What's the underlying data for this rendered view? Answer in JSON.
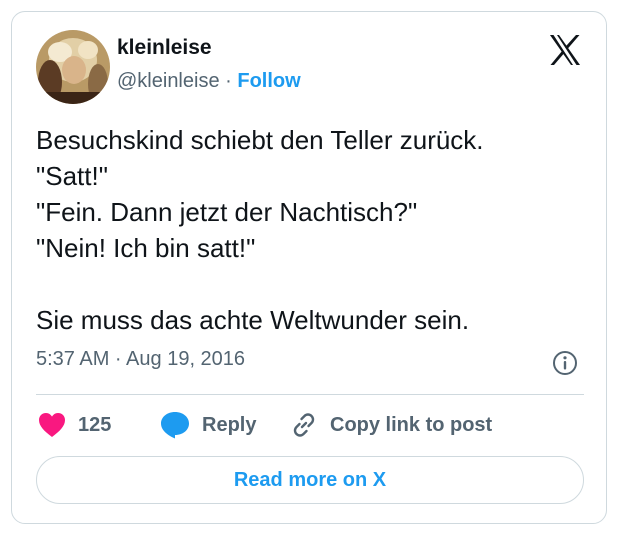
{
  "author": {
    "display_name": "kleinleise",
    "handle": "@kleinleise",
    "separator": "·",
    "follow_label": "Follow"
  },
  "tweet": {
    "lines": [
      "Besuchskind schiebt den Teller zurück.",
      "\"Satt!\"",
      "\"Fein. Dann jetzt der Nachtisch?\"",
      "\"Nein! Ich bin satt!\"",
      "",
      "Sie muss das achte Weltwunder sein."
    ],
    "timestamp": "5:37 AM · Aug 19, 2016"
  },
  "actions": {
    "like_count": "125",
    "reply_label": "Reply",
    "copy_link_label": "Copy link to post"
  },
  "footer": {
    "read_more_label": "Read more on X"
  },
  "icons": {
    "like": "heart-icon",
    "reply": "speech-bubble-icon",
    "copy": "link-icon",
    "info": "info-icon",
    "brand": "x-logo-icon"
  },
  "colors": {
    "like": "#f91880",
    "accent": "#1d9bf0",
    "text_primary": "#0f1419",
    "text_secondary": "#536471",
    "border": "#cfd9de"
  }
}
